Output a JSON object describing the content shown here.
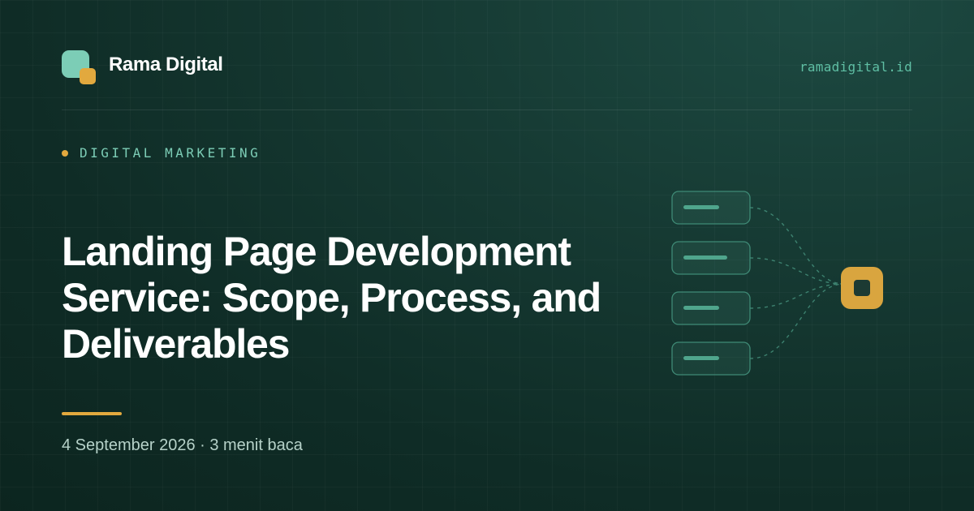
{
  "brand": {
    "name": "Rama Digital",
    "url": "ramadigital.id"
  },
  "category": "DIGITAL MARKETING",
  "title_lines": [
    "Landing Page Development",
    "Service: Scope, Process, and",
    "Deliverables"
  ],
  "meta": {
    "date": "4 September 2026",
    "separator": " · ",
    "read_time": "3 menit baca"
  },
  "colors": {
    "background": "#163a33",
    "accent": "#e2a93e",
    "mint": "#7ccdb6",
    "teal_text": "#5fbfa4"
  },
  "illustration": {
    "icons": [
      "content-block-icon",
      "content-block-icon",
      "content-block-icon",
      "content-block-icon",
      "hub-node-icon"
    ]
  }
}
